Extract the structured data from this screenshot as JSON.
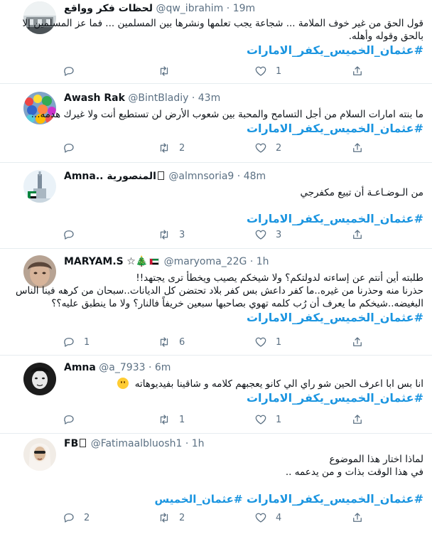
{
  "colors": {
    "link": "#1b95e0",
    "muted": "#5b7083",
    "divider": "#e6ecf0",
    "text": "#0f1419"
  },
  "icons": {
    "reply": "reply-icon",
    "retweet": "retweet-icon",
    "like": "heart-icon",
    "share": "share-icon"
  },
  "tweets": [
    {
      "name": "لحظات فكر وواقع",
      "handle": "@qw_ibrahim",
      "sep": "·",
      "time": "19m",
      "lines": [
        "قول الحق من غير خوف الملامة ... شجاعة يجب تعلمها ونشرها بين المسلمين ... فما عز المسلمين إلا",
        "بالحق وقوله وأهله."
      ],
      "hashtag": "#عثمان_الخميس_يكفر_الامارات",
      "replies": "",
      "retweets": "",
      "likes": "1"
    },
    {
      "name": "Awash Rak",
      "handle": "@BintBladiy",
      "sep": "·",
      "time": "43m",
      "lines": [
        "ما بنته امارات السلام من أجل التسامح والمحبة  بين شعوب الأرض لن تستطيع أنت ولا غيرك هدمه..."
      ],
      "hashtag": "#عثمان_الخميس_يكفر_الامارات",
      "replies": "",
      "retweets": "2",
      "likes": "2"
    },
    {
      "name": "Amna.. المنصورية",
      "handle": "@almnsoria9",
      "sep": "·",
      "time": "48m",
      "lines": [
        "من الـوضـاعـة أن تبيع مكفرجي"
      ],
      "hashtag": "#عثمان_الخميس_يكفر_الامارات",
      "replies": "",
      "retweets": "3",
      "likes": "3"
    },
    {
      "name": "MARYAM.S",
      "handle": "@maryoma_22G",
      "sep": "·",
      "time": "1h",
      "lines": [
        "طلبته أين أنتم عن إساءته لدولتكم؟ ولا شيخكم يصيب ويخطأ ترى يجتهد!!",
        "حذرنا منه وحذرنا من غيره..ما كفر داعش بس كفر بلاد تحتضن كل الديانات..سبحان من كرهه فينا الناس",
        "البغيضه..شيخكم ما يعرف أن رُب كلمه تهوي بصاحبها سبعين خريفاً فالنار؟ ولا ما ينطبق عليه؟؟"
      ],
      "hashtag": "#عثمان_الخميس_يكفر_الامارات",
      "replies": "1",
      "retweets": "6",
      "likes": "1"
    },
    {
      "name": "Amna",
      "handle": "@a_7933",
      "sep": "·",
      "time": "6m",
      "lines": [
        "انا بس ابا اعرف الحين شو راي الي كانو يعجبهم كلامه و شاقينا بفيديوهاته"
      ],
      "hashtag": "#عثمان_الخميس_يكفر_الامارات",
      "replies": "",
      "retweets": "1",
      "likes": "1"
    },
    {
      "name": "FB",
      "handle": "@Fatimaalbluosh1",
      "sep": "·",
      "time": "1h",
      "lines": [
        "لماذا اختار هذا الموضوع",
        "في هذا الوقت بذات و من يدعمه .."
      ],
      "hashtag": "#عثمان_الخميس_يكفر_الامارات",
      "hashtag_plain": "#عثمان_الخميس",
      "replies": "2",
      "retweets": "2",
      "likes": "4"
    }
  ]
}
